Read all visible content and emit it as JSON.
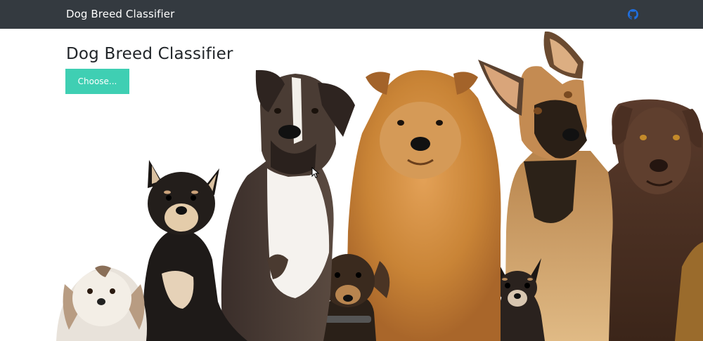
{
  "navbar": {
    "brand": "Dog Breed Classifier",
    "github_icon": "github-icon",
    "brand_color": "#343a40",
    "icon_color": "#1f6fe0"
  },
  "main": {
    "title": "Dog Breed Classifier",
    "choose_label": "Choose...",
    "accent": "#3fcfb3"
  },
  "hero_image": {
    "dogs": [
      "shih-tzu",
      "shiba-inu",
      "boxer",
      "dachshund",
      "chow-chow",
      "chihuahua",
      "german-shepherd",
      "chocolate-labrador"
    ]
  }
}
